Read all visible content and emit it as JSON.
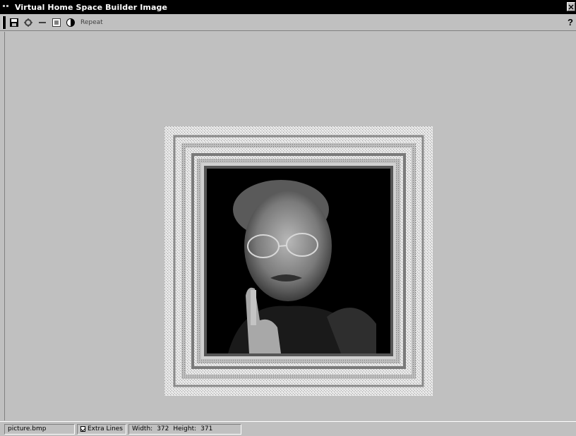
{
  "window": {
    "title": "Virtual Home Space Builder Image"
  },
  "toolbar": {
    "buttons": [
      {
        "icon": "save-icon"
      },
      {
        "icon": "gear-icon"
      },
      {
        "icon": "minus-icon"
      },
      {
        "icon": "image-icon"
      },
      {
        "icon": "contrast-icon"
      }
    ],
    "label": "Repeat",
    "help": "?"
  },
  "image": {
    "description_icon": "framed-portrait-image"
  },
  "status": {
    "filename": "picture.bmp",
    "extra_label": "Extra Lines",
    "extra_checked": true,
    "width_label": "Width:",
    "width_value": "372",
    "height_label": "Height:",
    "height_value": "371"
  },
  "colors": {
    "titlebar": "#000000",
    "face": "#c0c0c0",
    "frame": "#d8d8d8",
    "portrait_bg": "#000000"
  }
}
